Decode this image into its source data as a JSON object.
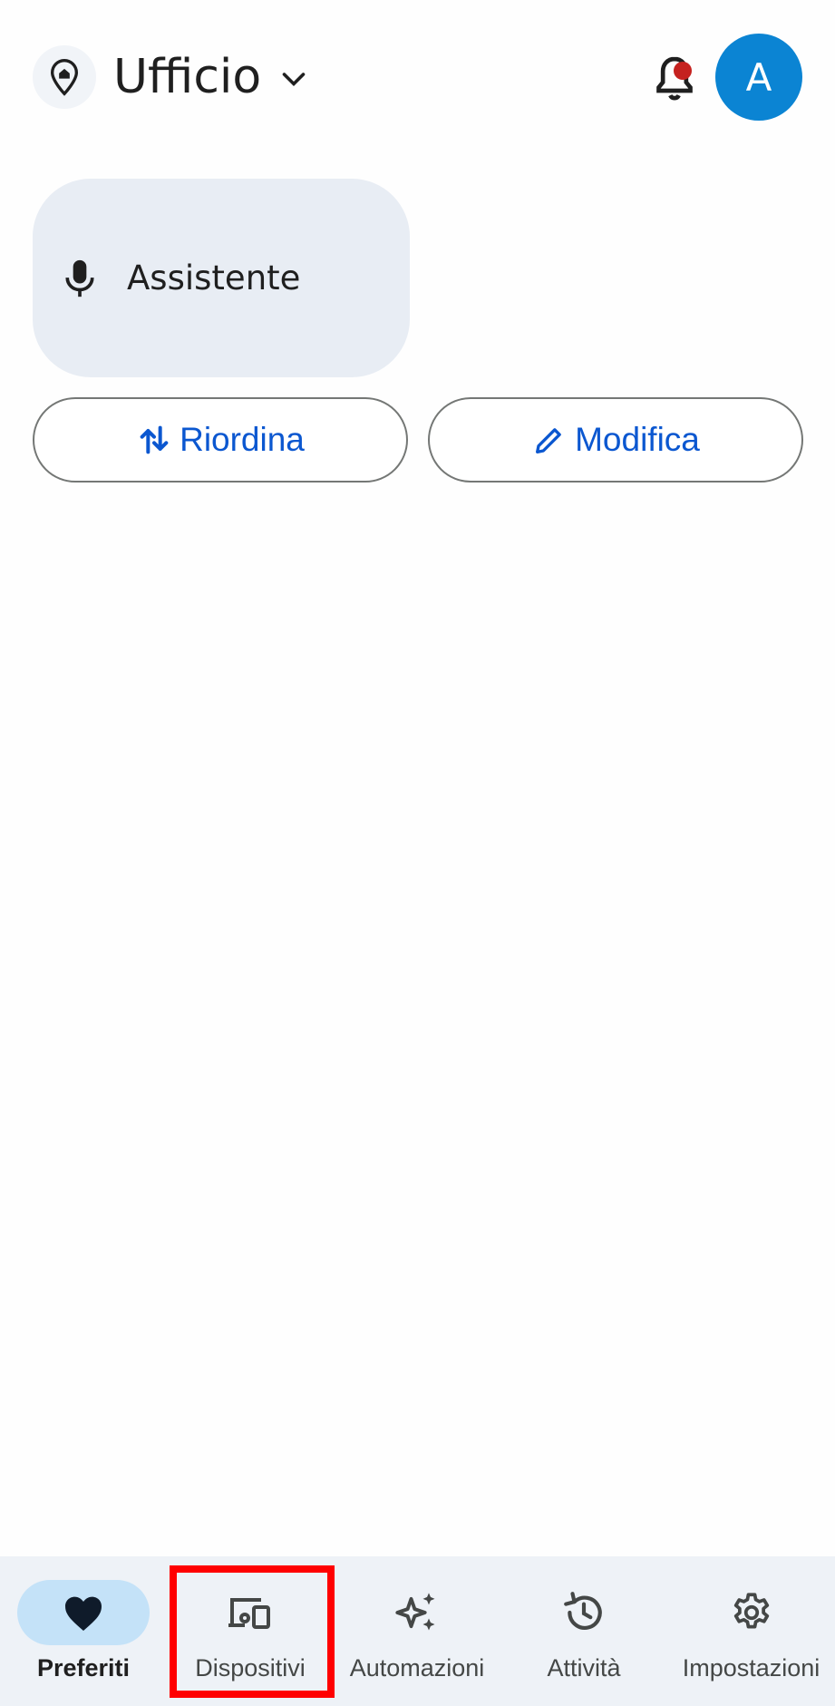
{
  "header": {
    "home_name": "Ufficio",
    "avatar_letter": "A"
  },
  "assistant_card": {
    "label": "Assistente"
  },
  "actions": {
    "reorder_label": "Riordina",
    "edit_label": "Modifica"
  },
  "bottom_nav": {
    "items": [
      {
        "label": "Preferiti",
        "icon": "heart-icon",
        "active": true
      },
      {
        "label": "Dispositivi",
        "icon": "devices-icon",
        "active": false
      },
      {
        "label": "Automazioni",
        "icon": "sparkle-icon",
        "active": false
      },
      {
        "label": "Attività",
        "icon": "history-icon",
        "active": false
      },
      {
        "label": "Impostazioni",
        "icon": "gear-icon",
        "active": false
      }
    ]
  },
  "colors": {
    "accent": "#0b57d0",
    "avatar_bg": "#0b84d3",
    "notification_dot": "#c5221f",
    "active_nav_pill": "#c4e2f8",
    "card_bg": "#e8edf4",
    "highlight_box": "#ff0000"
  }
}
